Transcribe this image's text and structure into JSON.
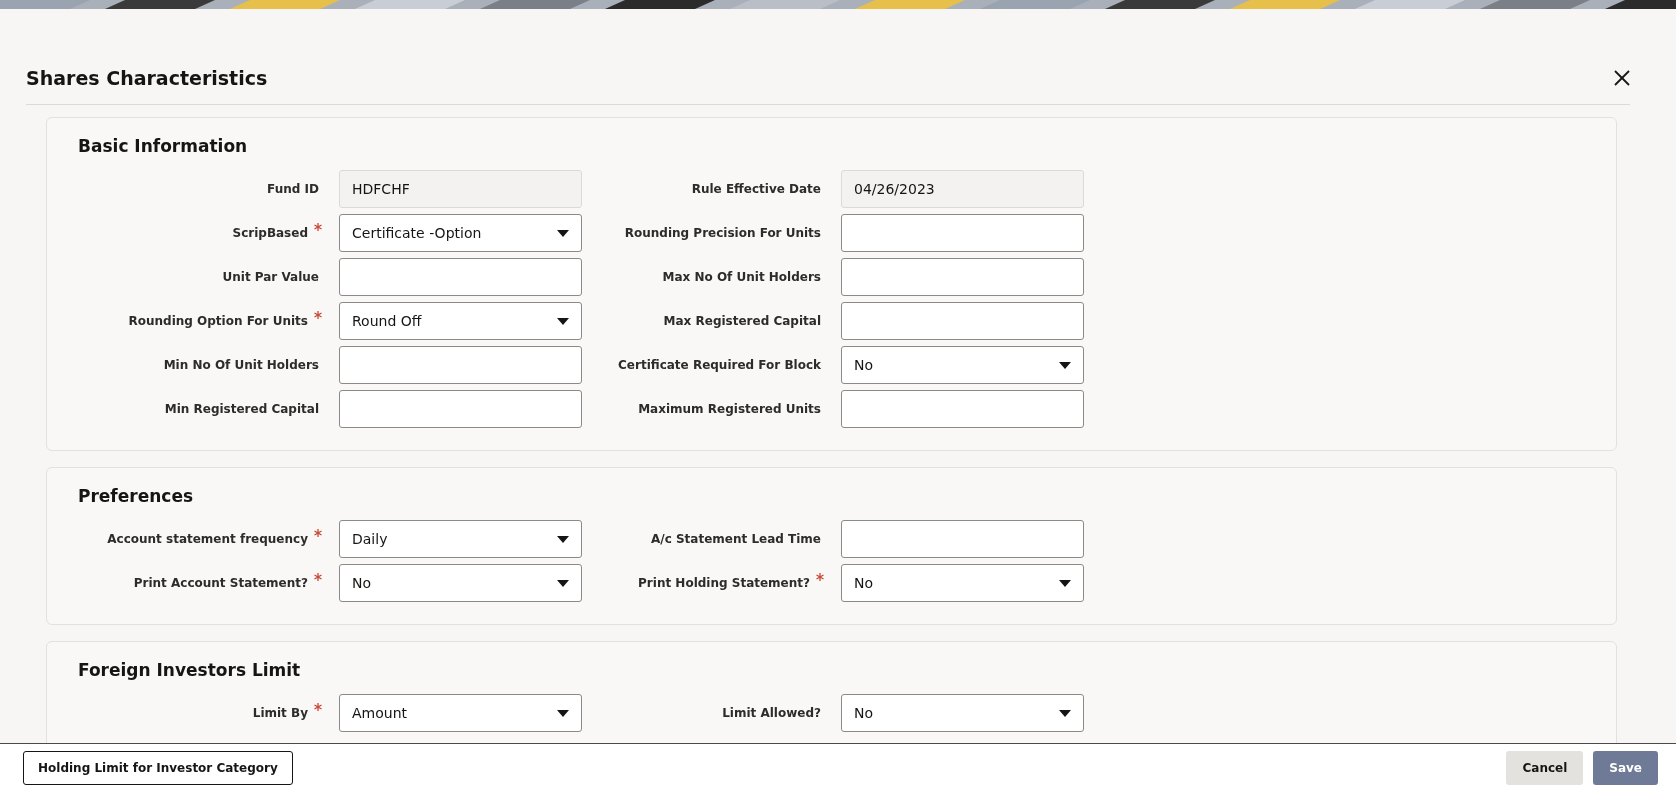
{
  "dialog": {
    "title": "Shares Characteristics"
  },
  "sections": [
    {
      "title": "Basic Information",
      "rows": [
        [
          {
            "label": "Fund ID",
            "required": false,
            "kind": "readonly",
            "value": "HDFCHF"
          },
          {
            "label": "Rule Effective Date",
            "required": false,
            "kind": "readonly",
            "value": "04/26/2023"
          }
        ],
        [
          {
            "label": "ScripBased",
            "required": true,
            "kind": "select",
            "value": "Certificate -Option"
          },
          {
            "label": "Rounding Precision For Units",
            "required": false,
            "kind": "text"
          }
        ],
        [
          {
            "label": "Unit Par Value",
            "required": false,
            "kind": "text"
          },
          {
            "label": "Max No Of Unit Holders",
            "required": false,
            "kind": "text"
          }
        ],
        [
          {
            "label": "Rounding Option For Units",
            "required": true,
            "kind": "select",
            "value": "Round Off"
          },
          {
            "label": "Max Registered Capital",
            "required": false,
            "kind": "text"
          }
        ],
        [
          {
            "label": "Min No Of Unit Holders",
            "required": false,
            "kind": "text"
          },
          {
            "label": "Certificate Required For Block",
            "required": false,
            "kind": "select",
            "value": "No"
          }
        ],
        [
          {
            "label": "Min Registered Capital",
            "required": false,
            "kind": "text"
          },
          {
            "label": "Maximum Registered Units",
            "required": false,
            "kind": "text"
          }
        ]
      ]
    },
    {
      "title": "Preferences",
      "rows": [
        [
          {
            "label": "Account statement frequency",
            "required": true,
            "kind": "select",
            "value": "Daily"
          },
          {
            "label": "A/c Statement Lead Time",
            "required": false,
            "kind": "text"
          }
        ],
        [
          {
            "label": "Print Account Statement?",
            "required": true,
            "kind": "select",
            "value": "No"
          },
          {
            "label": "Print Holding Statement?",
            "required": true,
            "kind": "select",
            "value": "No"
          }
        ]
      ]
    },
    {
      "title": "Foreign Investors Limit",
      "rows": [
        [
          {
            "label": "Limit By",
            "required": true,
            "kind": "select",
            "value": "Amount"
          },
          {
            "label": "Limit Allowed?",
            "required": false,
            "kind": "select",
            "value": "No"
          }
        ]
      ]
    }
  ],
  "footer": {
    "left_button": "Holding Limit for Investor Category",
    "cancel": "Cancel",
    "save": "Save"
  }
}
